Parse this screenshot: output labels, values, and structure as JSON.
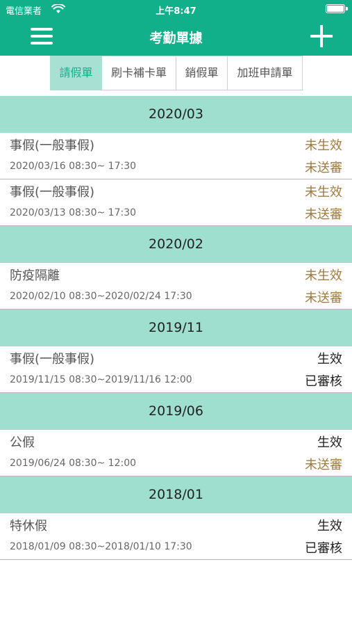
{
  "status_bar": {
    "carrier": "電信業者",
    "time": "上午8:47"
  },
  "nav": {
    "title": "考勤單據"
  },
  "tabs": [
    {
      "label": "請假單",
      "active": true
    },
    {
      "label": "刷卡補卡單",
      "active": false
    },
    {
      "label": "銷假單",
      "active": false
    },
    {
      "label": "加班申請單",
      "active": false
    }
  ],
  "colors": {
    "accent": "#12b08a",
    "section": "#9fdfcf",
    "pending": "#a07a3e"
  },
  "sections": [
    {
      "month": "2020/03",
      "items": [
        {
          "title": "事假(一般事假)",
          "date": "2020/03/16 08:30~ 17:30",
          "status": "未生效",
          "review": "未送審"
        },
        {
          "title": "事假(一般事假)",
          "date": "2020/03/13 08:30~ 17:30",
          "status": "未生效",
          "review": "未送審"
        }
      ]
    },
    {
      "month": "2020/02",
      "items": [
        {
          "title": "防疫隔離",
          "date": "2020/02/10 08:30~2020/02/24 17:30",
          "status": "未生效",
          "review": "未送審"
        }
      ]
    },
    {
      "month": "2019/11",
      "items": [
        {
          "title": "事假(一般事假)",
          "date": "2019/11/15 08:30~2019/11/16 12:00",
          "status": "生效",
          "review": "已審核"
        }
      ]
    },
    {
      "month": "2019/06",
      "items": [
        {
          "title": "公假",
          "date": "2019/06/24 08:30~ 12:00",
          "status": "生效",
          "review": "未送審"
        }
      ]
    },
    {
      "month": "2018/01",
      "items": [
        {
          "title": "特休假",
          "date": "2018/01/09 08:30~2018/01/10 17:30",
          "status": "生效",
          "review": "已審核"
        }
      ]
    }
  ]
}
